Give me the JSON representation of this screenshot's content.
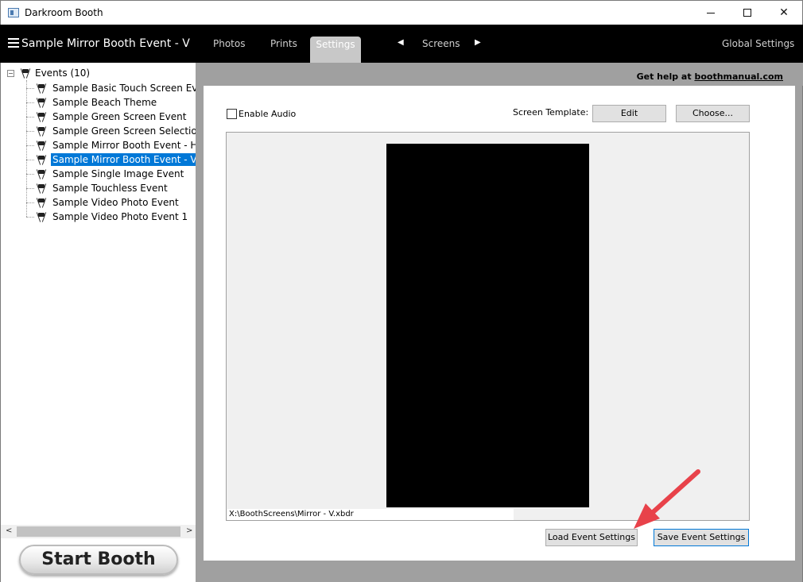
{
  "window": {
    "title": "Darkroom Booth",
    "min_glyph": "—",
    "close_glyph": "✕"
  },
  "topnav": {
    "event_title": "Sample Mirror Booth Event - V",
    "tabs": [
      {
        "label": "Photos"
      },
      {
        "label": "Prints"
      },
      {
        "label": "Settings",
        "active": true
      }
    ],
    "screens_label": "Screens",
    "arrow_left": "◀",
    "arrow_right": "▶",
    "global_settings": "Global Settings"
  },
  "tree": {
    "expander_glyph": "−",
    "root_label": "Events (10)",
    "items": [
      {
        "label": "Sample Basic Touch Screen Event"
      },
      {
        "label": "Sample Beach Theme"
      },
      {
        "label": "Sample Green Screen Event"
      },
      {
        "label": "Sample Green Screen Selection"
      },
      {
        "label": "Sample Mirror Booth Event - H"
      },
      {
        "label": "Sample Mirror Booth Event - V",
        "selected": true
      },
      {
        "label": "Sample Single Image Event"
      },
      {
        "label": "Sample Touchless Event"
      },
      {
        "label": "Sample Video Photo Event"
      },
      {
        "label": "Sample Video Photo Event  1"
      }
    ]
  },
  "scrollbar": {
    "left_arrow": "<",
    "right_arrow": ">"
  },
  "start_booth": "Start Booth",
  "help": {
    "prefix": "Get help at ",
    "link": "boothmanual.com"
  },
  "settings": {
    "enable_audio_label": "Enable Audio",
    "enable_audio_checked": false,
    "screen_template_label": "Screen Template:",
    "edit_button": "Edit",
    "choose_button": "Choose...",
    "template_path": "X:\\BoothScreens\\Mirror - V.xbdr",
    "load_button": "Load Event Settings",
    "save_button": "Save Event Settings"
  },
  "colors": {
    "selection": "#0078d7",
    "annotation_arrow": "#e8424a",
    "nav_bg": "#000000",
    "active_tab": "#c8c8c8"
  }
}
